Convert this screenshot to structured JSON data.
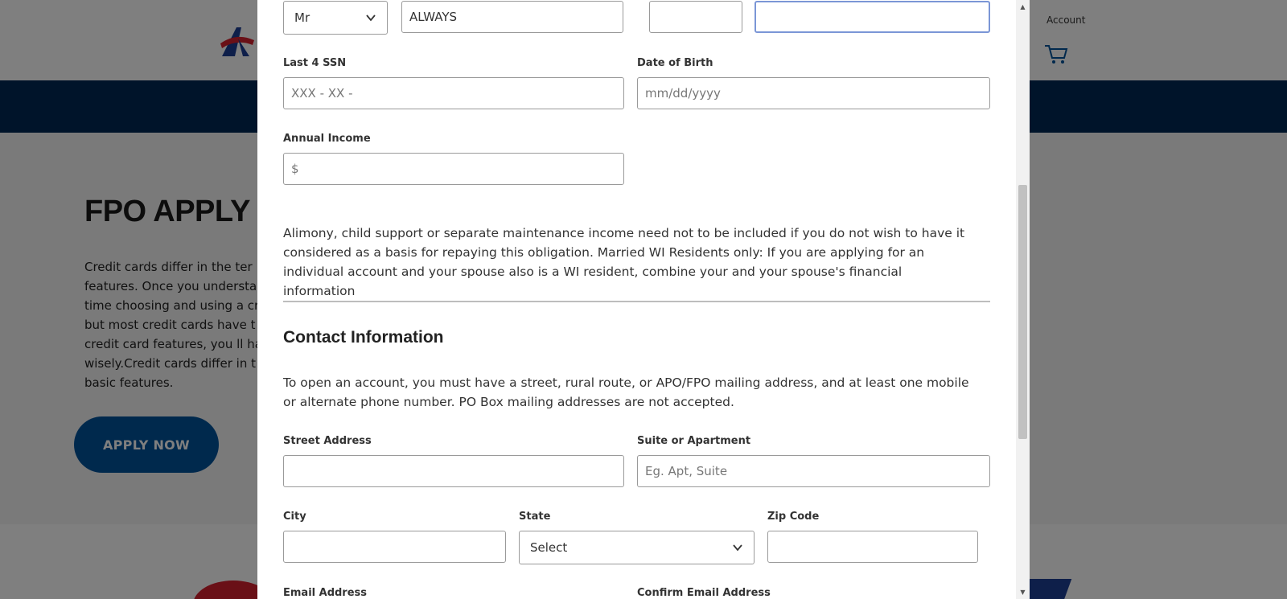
{
  "background": {
    "header": {
      "account_label": "Account"
    },
    "hero": {
      "title": "FPO APPLY T",
      "body_lines": [
        "Credit cards differ in the ter",
        "features. Once you understa",
        "time choosing and using a cr",
        "but most credit cards have t",
        "credit card features, you ll ha",
        "wisely.Credit cards differ in t",
        "basic features."
      ],
      "apply_button": "APPLY NOW"
    }
  },
  "modal": {
    "name_row": {
      "title_select": "Mr",
      "first_name_value": "ALWAYS",
      "middle_initial_value": "",
      "last_name_value": ""
    },
    "ssn": {
      "label": "Last 4 SSN",
      "placeholder": "XXX - XX -"
    },
    "dob": {
      "label": "Date of Birth",
      "placeholder": "mm/dd/yyyy"
    },
    "income": {
      "label": "Annual Income",
      "placeholder": "$"
    },
    "income_disclaimer": "Alimony, child support or separate maintenance income need not to be included if you do not wish to have it considered as a basis for repaying this obligation. Married WI Residents only: If you are applying for an individual account and your spouse also is a WI resident,  combine your and your spouse's financial information",
    "contact": {
      "title": "Contact Information",
      "intro": "To open an account, you must have a street, rural route, or APO/FPO mailing address, and at least one mobile or alternate phone number. PO Box mailing addresses are not accepted.",
      "street": {
        "label": "Street Address",
        "placeholder": ""
      },
      "suite": {
        "label": "Suite or Apartment",
        "placeholder": "Eg. Apt, Suite"
      },
      "city": {
        "label": "City"
      },
      "state": {
        "label": "State",
        "value": "Select"
      },
      "zip": {
        "label": "Zip Code"
      },
      "email": {
        "label": "Email Address"
      },
      "confirm_email": {
        "label": "Confirm Email Address"
      }
    }
  },
  "colors": {
    "nav_bar": "#002855",
    "apply_button": "#00529b",
    "focus_border": "#7b96d6",
    "logo_red": "#d5202f",
    "logo_blue": "#1c3f94"
  },
  "icons": {
    "select_arrow": "chevron-down-icon",
    "cart": "cart-icon",
    "logo": "logo-icon"
  },
  "scrollbar": {
    "position_fraction": 0.32
  }
}
